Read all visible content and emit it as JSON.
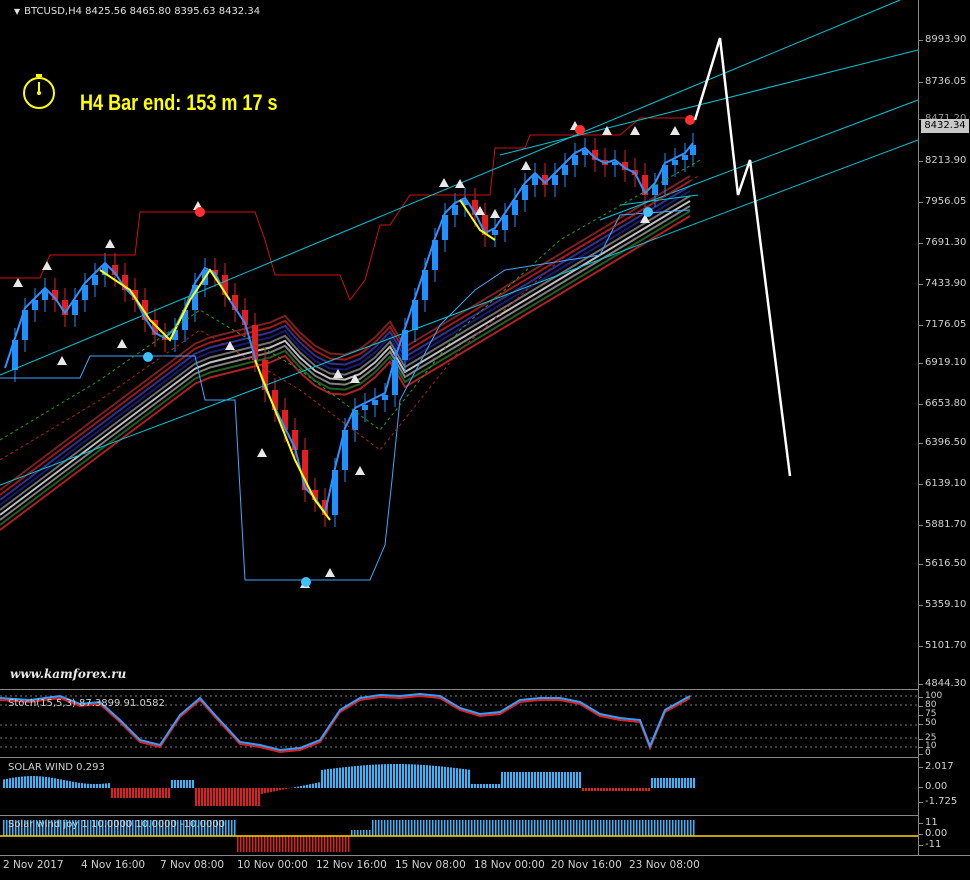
{
  "chart": {
    "symbol_info": "BTCUSD,H4  8425.56 8465.80 8395.63 8432.34",
    "bar_timer": "H4 Bar end: 153 m 17 s",
    "watermark": "www.kamforex.ru",
    "last_price": "8432.34"
  },
  "price_scale": [
    "8993.90",
    "8736.05",
    "8471.20",
    "8213.90",
    "7956.05",
    "7691.30",
    "7433.90",
    "7176.05",
    "6919.10",
    "6653.80",
    "6396.50",
    "6139.10",
    "5881.70",
    "5616.50",
    "5359.10",
    "5101.70",
    "4844.30"
  ],
  "stoch": {
    "label": "Stoch(15,5,3) 87.3899 91.0582",
    "scale": [
      "100",
      "80",
      "75",
      "50",
      "25",
      "10",
      "0"
    ]
  },
  "solar_wind": {
    "label": "SOLAR WIND 0.293",
    "scale": [
      "2.017",
      "0.00",
      "-1.725"
    ]
  },
  "solar_wind_joy": {
    "label": "Solar wind joy 1 10.0000 10.0000 -10.0000",
    "scale": [
      "11",
      "0.00",
      "-11"
    ]
  },
  "time_axis": [
    "2 Nov 2017",
    "4 Nov 16:00",
    "7 Nov 08:00",
    "10 Nov 00:00",
    "12 Nov 16:00",
    "15 Nov 08:00",
    "18 Nov 00:00",
    "20 Nov 16:00",
    "23 Nov 08:00"
  ],
  "colors": {
    "background": "#000000",
    "bull_candle": "#1e90ff",
    "bear_candle": "#e02020",
    "channel_line": "#00c8d8",
    "signal_line": "#ffff00",
    "forecast_line": "#ffffff",
    "timer_text": "#ffff00"
  }
}
